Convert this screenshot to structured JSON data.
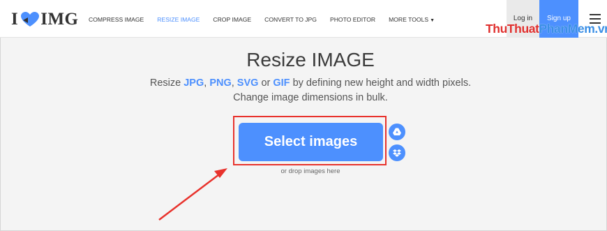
{
  "header": {
    "logo": {
      "left": "I",
      "right": "IMG"
    },
    "nav": [
      {
        "label": "COMPRESS IMAGE",
        "active": false
      },
      {
        "label": "RESIZE IMAGE",
        "active": true
      },
      {
        "label": "CROP IMAGE",
        "active": false
      },
      {
        "label": "CONVERT TO JPG",
        "active": false
      },
      {
        "label": "PHOTO EDITOR",
        "active": false
      },
      {
        "label": "MORE TOOLS",
        "active": false
      }
    ],
    "login_label": "Log in",
    "signup_label": "Sign up",
    "menu_icon": "hamburger-menu-icon"
  },
  "watermark": {
    "part1": "ThuThuat",
    "part2": "PhanMem",
    "part3": ".vn"
  },
  "main": {
    "title": "Resize IMAGE",
    "desc_prefix": "Resize ",
    "formats": [
      "JPG",
      "PNG",
      "SVG",
      "GIF"
    ],
    "sep_comma": ", ",
    "sep_or": " or ",
    "desc_suffix": " by defining new height and width pixels.",
    "desc_line2": "Change image dimensions in bulk.",
    "select_label": "Select images",
    "drop_text": "or drop images here",
    "gdrive_icon": "google-drive-icon",
    "dropbox_icon": "dropbox-icon"
  },
  "colors": {
    "accent": "#4d90fe",
    "highlight": "#e8322c",
    "watermark_red": "#e0302e",
    "watermark_blue": "#3a8fe6"
  }
}
